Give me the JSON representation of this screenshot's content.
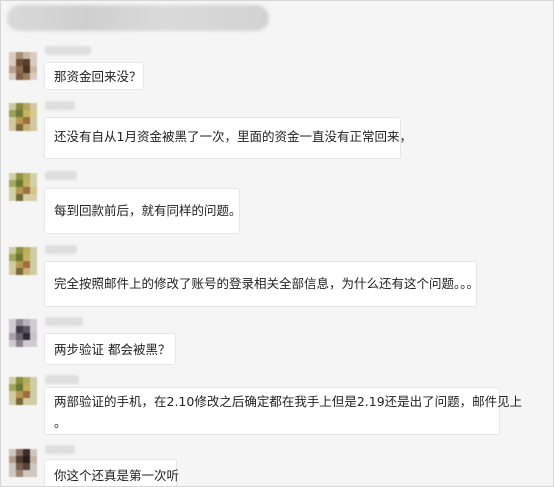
{
  "messages": [
    {
      "text": "那资金回来没？"
    },
    {
      "text": "还没有自从1月资金被黑了一次，里面的资金一直没有正常回来，"
    },
    {
      "text": "每到回款前后，就有同样的问题。"
    },
    {
      "text": "完全按照邮件上的修改了账号的登录相关全部信息，为什么还有这个问题。。。"
    },
    {
      "text": "两步验证  都会被黑？"
    },
    {
      "text": "两部验证的手机，在2.10修改之后确定都在我手上但是2.19还是出了问题，邮件见上",
      "text2": "。"
    },
    {
      "text": "你这个还真是第一次听"
    }
  ]
}
